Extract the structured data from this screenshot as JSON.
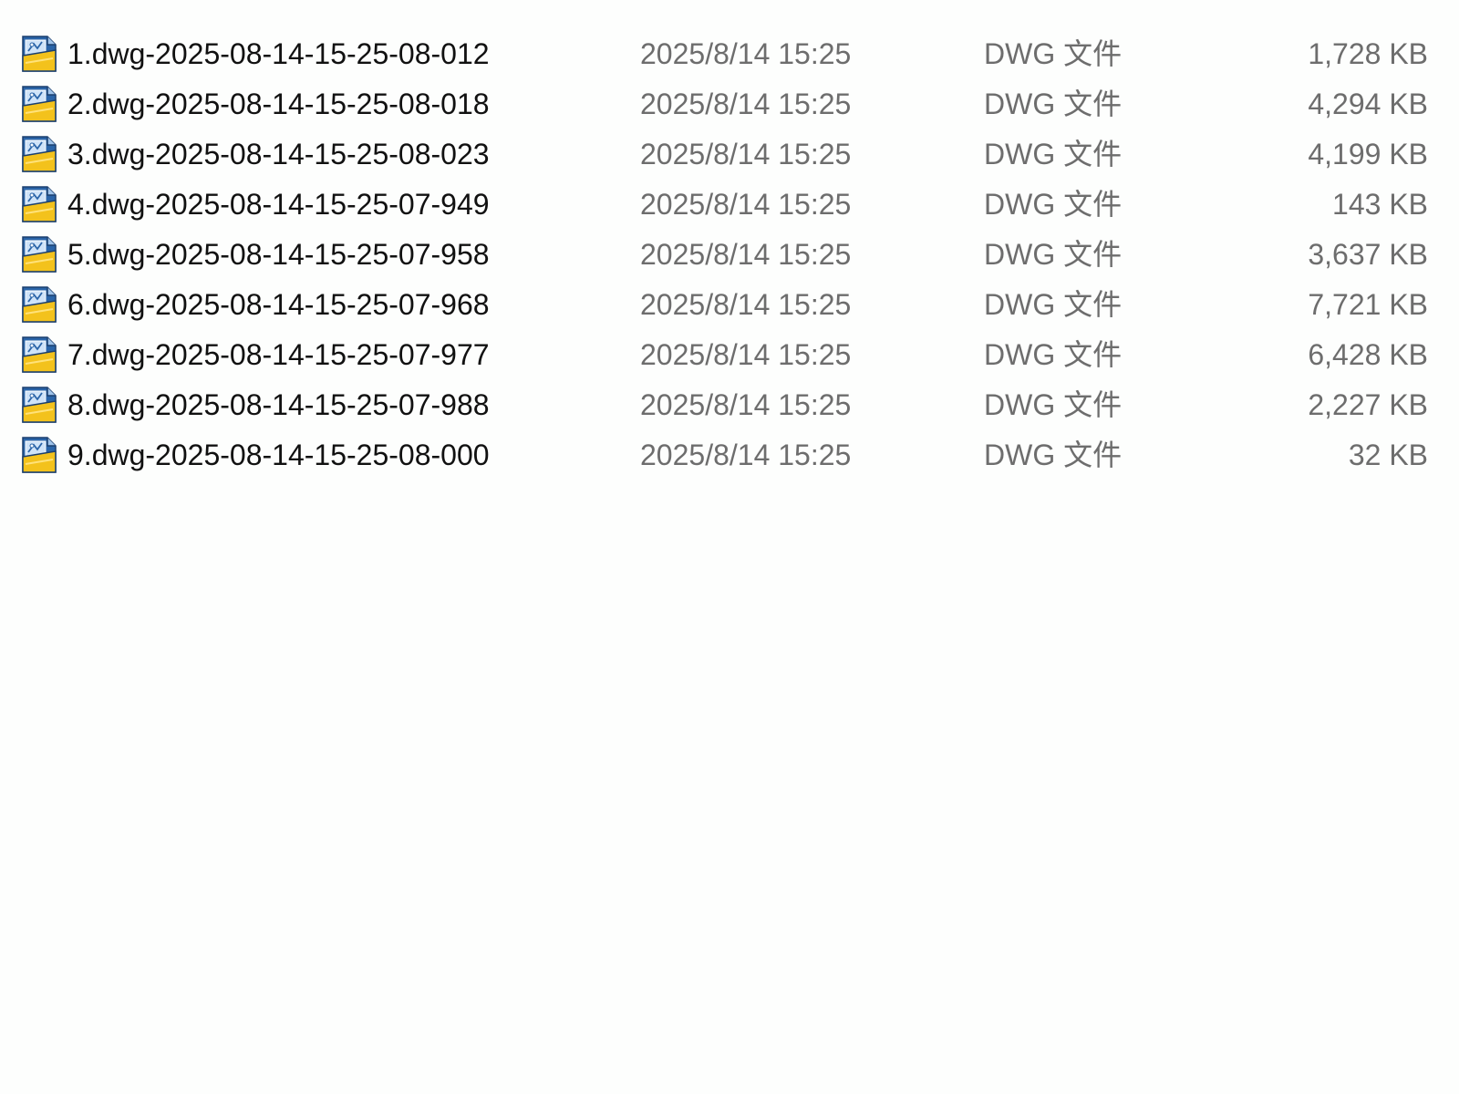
{
  "files": [
    {
      "name": "1.dwg-2025-08-14-15-25-08-012",
      "date": "2025/8/14 15:25",
      "type": "DWG 文件",
      "size": "1,728 KB"
    },
    {
      "name": "2.dwg-2025-08-14-15-25-08-018",
      "date": "2025/8/14 15:25",
      "type": "DWG 文件",
      "size": "4,294 KB"
    },
    {
      "name": "3.dwg-2025-08-14-15-25-08-023",
      "date": "2025/8/14 15:25",
      "type": "DWG 文件",
      "size": "4,199 KB"
    },
    {
      "name": "4.dwg-2025-08-14-15-25-07-949",
      "date": "2025/8/14 15:25",
      "type": "DWG 文件",
      "size": "143 KB"
    },
    {
      "name": "5.dwg-2025-08-14-15-25-07-958",
      "date": "2025/8/14 15:25",
      "type": "DWG 文件",
      "size": "3,637 KB"
    },
    {
      "name": "6.dwg-2025-08-14-15-25-07-968",
      "date": "2025/8/14 15:25",
      "type": "DWG 文件",
      "size": "7,721 KB"
    },
    {
      "name": "7.dwg-2025-08-14-15-25-07-977",
      "date": "2025/8/14 15:25",
      "type": "DWG 文件",
      "size": "6,428 KB"
    },
    {
      "name": "8.dwg-2025-08-14-15-25-07-988",
      "date": "2025/8/14 15:25",
      "type": "DWG 文件",
      "size": "2,227 KB"
    },
    {
      "name": "9.dwg-2025-08-14-15-25-08-000",
      "date": "2025/8/14 15:25",
      "type": "DWG 文件",
      "size": "32 KB"
    }
  ],
  "icon": "dwg-file-icon",
  "colors": {
    "name_text": "#111111",
    "meta_text": "#6d6d6d",
    "background": "#fdfefd",
    "icon_blue": "#2a64a8",
    "icon_yellow": "#f3c21c"
  }
}
